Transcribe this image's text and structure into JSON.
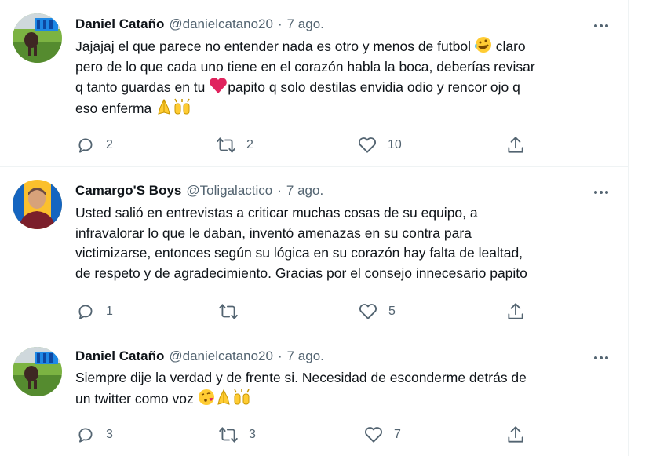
{
  "tweets": [
    {
      "name": "Daniel Cataño",
      "handle": "@danielcatano20",
      "separator": "·",
      "date": "7 ago.",
      "text_lines": [
        "Jajajaj el que parece no entender nada es otro y menos de futbol",
        "claro",
        "pero de lo que cada uno tiene en el corazón habla la boca, deberías revisar",
        "q tanto guardas en tu",
        "papito q solo destilas envidia odio y rencor ojo q",
        "eso enferma"
      ],
      "reply_count": "2",
      "retweet_count": "2",
      "like_count": "10"
    },
    {
      "name": "Camargo'S Boys",
      "handle": "@Toligalactico",
      "separator": "·",
      "date": "7 ago.",
      "text_lines": [
        "Usted salió en entrevistas a criticar muchas cosas de su equipo, a",
        "infravalorar lo que le daban, inventó amenazas en su contra para",
        "victimizarse, entonces según su lógica en su corazón hay falta de lealtad,",
        "de respeto y de agradecimiento. Gracias por el consejo innecesario papito"
      ],
      "reply_count": "1",
      "retweet_count": "",
      "like_count": "5"
    },
    {
      "name": "Daniel Cataño",
      "handle": "@danielcatano20",
      "separator": "·",
      "date": "7 ago.",
      "text_lines": [
        "Siempre dije la verdad y de frente si. Necesidad de esconderme detrás de",
        "un twitter como voz"
      ],
      "reply_count": "3",
      "retweet_count": "3",
      "like_count": "7"
    }
  ],
  "icons": {
    "reply": "reply-icon",
    "retweet": "retweet-icon",
    "like": "like-icon",
    "share": "share-icon",
    "more": "more-icon"
  },
  "colors": {
    "text": "#0f1419",
    "secondary": "#536471",
    "divider": "#eff3f4",
    "heart_emoji": "#e0245e"
  }
}
